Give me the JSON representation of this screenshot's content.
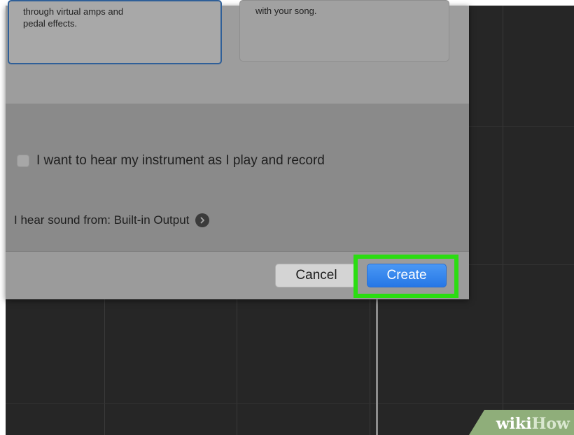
{
  "dialog": {
    "cards": [
      {
        "description": "through virtual amps and\npedal effects.",
        "selected": true
      },
      {
        "description": "with your song.",
        "selected": false
      }
    ],
    "monitor_checkbox": {
      "label": "I want to hear my instrument as I play and record",
      "checked": false
    },
    "output": {
      "prefix": "I hear sound from: ",
      "device": "Built-in Output",
      "icon": "chevron-right-circle-icon"
    },
    "buttons": {
      "cancel_label": "Cancel",
      "create_label": "Create"
    }
  },
  "highlight": {
    "target": "create-button",
    "color": "#2bdd12"
  },
  "colors": {
    "accent": "#2677e6",
    "workspace": "#262626"
  },
  "watermark": {
    "wiki": "wiki",
    "how": "How"
  }
}
